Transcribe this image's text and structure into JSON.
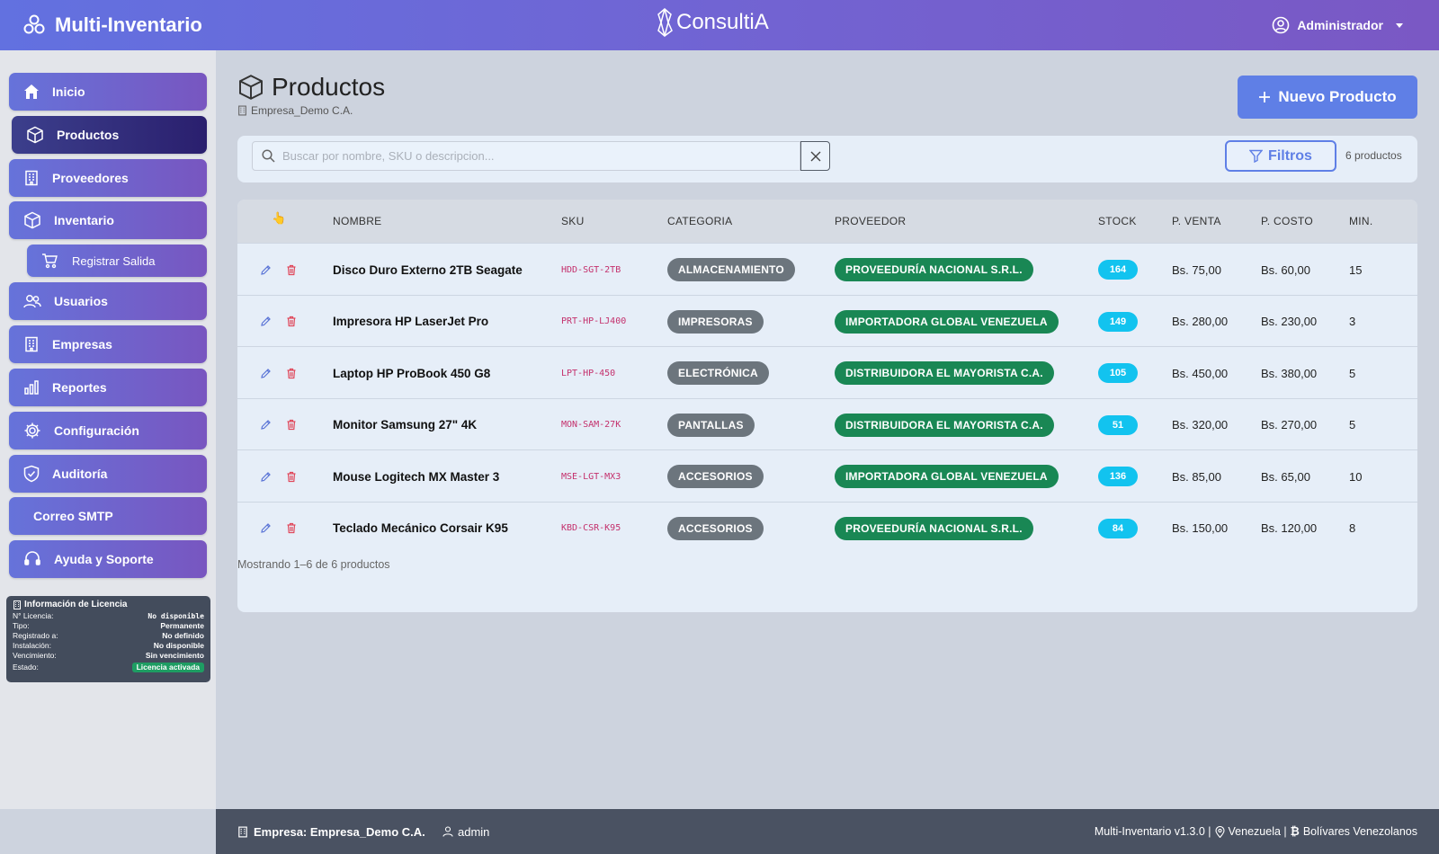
{
  "app": {
    "title": "Multi-Inventario",
    "center_logo": "ConsultiA"
  },
  "user_menu": {
    "label": "Administrador"
  },
  "sidebar": {
    "items": [
      {
        "label": "Inicio",
        "icon": "home-icon"
      },
      {
        "label": "Productos",
        "icon": "box-icon",
        "active": true
      },
      {
        "label": "Proveedores",
        "icon": "building-icon"
      },
      {
        "label": "Inventario",
        "icon": "box-icon"
      },
      {
        "label": "Registrar Salida",
        "icon": "cart-icon",
        "sub": true
      },
      {
        "label": "Usuarios",
        "icon": "users-icon"
      },
      {
        "label": "Empresas",
        "icon": "building-icon"
      },
      {
        "label": "Reportes",
        "icon": "bar-chart-icon"
      },
      {
        "label": "Configuración",
        "icon": "gear-icon"
      },
      {
        "label": "Auditoría",
        "icon": "shield-check-icon"
      },
      {
        "label": "Correo SMTP",
        "icon": ""
      },
      {
        "label": "Ayuda y Soporte",
        "icon": "headset-icon"
      }
    ]
  },
  "license": {
    "title": "Información de Licencia",
    "rows": [
      {
        "label": "N° Licencia:",
        "value": "No disponible"
      },
      {
        "label": "Tipo:",
        "value": "Permanente"
      },
      {
        "label": "Registrado a:",
        "value": "No definido"
      },
      {
        "label": "Instalación:",
        "value": "No disponible"
      },
      {
        "label": "Vencimiento:",
        "value": "Sin vencimiento"
      },
      {
        "label": "Estado:",
        "value": "Licencia activada"
      }
    ]
  },
  "page": {
    "title": "Productos",
    "company": "Empresa_Demo C.A.",
    "new_button": "Nuevo Producto"
  },
  "search": {
    "placeholder": "Buscar por nombre, SKU o descripcion...",
    "filters_label": "Filtros",
    "count_label": "6 productos"
  },
  "table": {
    "headers": {
      "nombre": "NOMBRE",
      "sku": "SKU",
      "categoria": "CATEGORIA",
      "proveedor": "PROVEEDOR",
      "stock": "STOCK",
      "p_venta": "P. VENTA",
      "p_costo": "P. COSTO",
      "min": "MIN."
    },
    "rows": [
      {
        "nombre": "Disco Duro Externo 2TB Seagate",
        "sku": "HDD-SGT-2TB",
        "categoria": "ALMACENAMIENTO",
        "proveedor": "PROVEEDURÍA NACIONAL S.R.L.",
        "stock": "164",
        "p_venta": "Bs. 75,00",
        "p_costo": "Bs. 60,00",
        "min": "15"
      },
      {
        "nombre": "Impresora HP LaserJet Pro",
        "sku": "PRT-HP-LJ400",
        "categoria": "IMPRESORAS",
        "proveedor": "IMPORTADORA GLOBAL VENEZUELA",
        "stock": "149",
        "p_venta": "Bs. 280,00",
        "p_costo": "Bs. 230,00",
        "min": "3"
      },
      {
        "nombre": "Laptop HP ProBook 450 G8",
        "sku": "LPT-HP-450",
        "categoria": "ELECTRÓNICA",
        "proveedor": "DISTRIBUIDORA EL MAYORISTA C.A.",
        "stock": "105",
        "p_venta": "Bs. 450,00",
        "p_costo": "Bs. 380,00",
        "min": "5"
      },
      {
        "nombre": "Monitor Samsung 27\" 4K",
        "sku": "MON-SAM-27K",
        "categoria": "PANTALLAS",
        "proveedor": "DISTRIBUIDORA EL MAYORISTA C.A.",
        "stock": "51",
        "p_venta": "Bs. 320,00",
        "p_costo": "Bs. 270,00",
        "min": "5"
      },
      {
        "nombre": "Mouse Logitech MX Master 3",
        "sku": "MSE-LGT-MX3",
        "categoria": "ACCESORIOS",
        "proveedor": "IMPORTADORA GLOBAL VENEZUELA",
        "stock": "136",
        "p_venta": "Bs. 85,00",
        "p_costo": "Bs. 65,00",
        "min": "10"
      },
      {
        "nombre": "Teclado Mecánico Corsair K95",
        "sku": "KBD-CSR-K95",
        "categoria": "ACCESORIOS",
        "proveedor": "PROVEEDURÍA NACIONAL S.R.L.",
        "stock": "84",
        "p_venta": "Bs. 150,00",
        "p_costo": "Bs. 120,00",
        "min": "8"
      }
    ],
    "showing": "Mostrando 1–6 de 6 productos"
  },
  "footer": {
    "company": "Empresa: Empresa_Demo C.A.",
    "user": "admin",
    "version": "Multi-Inventario v1.3.0 |",
    "country": "Venezuela |",
    "currency": "Bolívares Venezolanos"
  },
  "colors": {
    "primary": "#6271e0",
    "accent": "#5f7fe6",
    "success": "#198754",
    "info": "#12c3ef",
    "secondary": "#6c757d"
  }
}
